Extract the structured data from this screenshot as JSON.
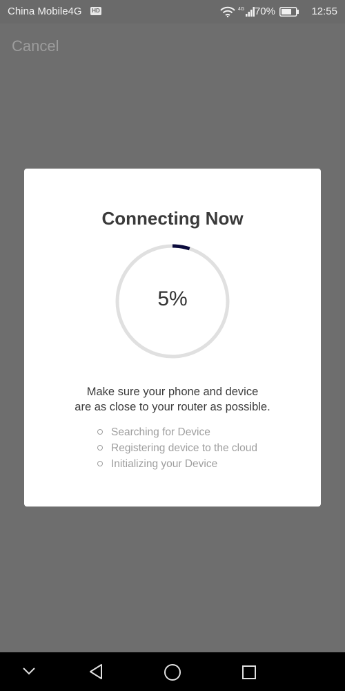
{
  "status_bar": {
    "carrier": "China Mobile4G",
    "hd_badge": "HD",
    "network_type": "4G",
    "battery_percent": "70%",
    "time": "12:55",
    "icons": [
      "wifi-icon",
      "signal-icon",
      "battery-icon"
    ]
  },
  "header": {
    "cancel_label": "Cancel"
  },
  "dialog": {
    "title": "Connecting Now",
    "progress": {
      "value": 5,
      "label": "5%"
    },
    "instruction_line1": "Make sure your phone and device",
    "instruction_line2": "are as close to your router as possible.",
    "steps": [
      "Searching for Device",
      "Registering device to the cloud",
      "Initializing your Device"
    ]
  },
  "colors": {
    "progress_track": "#e0e0e0",
    "progress_fill": "#0a0a3c",
    "overlay": "#6e6e6e"
  },
  "nav_bar": {
    "icons": [
      "chevron-down-icon",
      "back-icon",
      "home-icon",
      "recents-icon"
    ]
  }
}
